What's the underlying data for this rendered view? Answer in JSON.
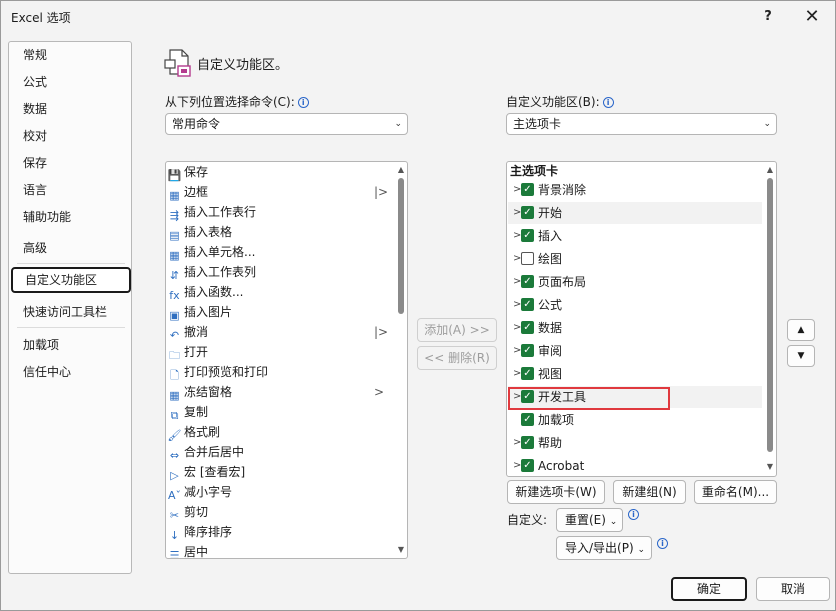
{
  "window": {
    "title": "Excel 选项",
    "help": "?",
    "close": "✕"
  },
  "sidebar": {
    "items": [
      {
        "label": "常规"
      },
      {
        "label": "公式"
      },
      {
        "label": "数据"
      },
      {
        "label": "校对"
      },
      {
        "label": "保存"
      },
      {
        "label": "语言"
      },
      {
        "label": "辅助功能"
      },
      {
        "label": "高级"
      },
      {
        "label": "自定义功能区",
        "active": true
      },
      {
        "label": "快速访问工具栏"
      },
      {
        "label": "加载项"
      },
      {
        "label": "信任中心"
      }
    ]
  },
  "header": {
    "title": "自定义功能区。",
    "icon": "customize-ribbon-icon"
  },
  "left": {
    "label": "从下列位置选择命令(C):",
    "select_value": "常用命令",
    "commands": [
      {
        "label": "保存",
        "icon": "save-icon",
        "glyph": "💾"
      },
      {
        "label": "边框",
        "icon": "border-icon",
        "glyph": "▦",
        "sub": "|>"
      },
      {
        "label": "插入工作表行",
        "icon": "insert-row-icon",
        "glyph": "⇶"
      },
      {
        "label": "插入表格",
        "icon": "table-icon",
        "glyph": "▤"
      },
      {
        "label": "插入单元格...",
        "icon": "insert-cells-icon",
        "glyph": "▦"
      },
      {
        "label": "插入工作表列",
        "icon": "insert-column-icon",
        "glyph": "⇵"
      },
      {
        "label": "插入函数...",
        "icon": "function-icon",
        "glyph": "fx"
      },
      {
        "label": "插入图片",
        "icon": "picture-icon",
        "glyph": "▣"
      },
      {
        "label": "撤消",
        "icon": "undo-icon",
        "glyph": "↶",
        "sub": "|>"
      },
      {
        "label": "打开",
        "icon": "open-folder-icon",
        "glyph": "🗀"
      },
      {
        "label": "打印预览和打印",
        "icon": "print-preview-icon",
        "glyph": "🗋"
      },
      {
        "label": "冻结窗格",
        "icon": "freeze-panes-icon",
        "glyph": "▦",
        "sub": ">"
      },
      {
        "label": "复制",
        "icon": "copy-icon",
        "glyph": "⧉"
      },
      {
        "label": "格式刷",
        "icon": "format-painter-icon",
        "glyph": "🖌"
      },
      {
        "label": "合并后居中",
        "icon": "merge-center-icon",
        "glyph": "⇔"
      },
      {
        "label": "宏 [查看宏]",
        "icon": "macro-play-icon",
        "glyph": "▷"
      },
      {
        "label": "减小字号",
        "icon": "decrease-font-icon",
        "glyph": "Aˇ"
      },
      {
        "label": "剪切",
        "icon": "scissors-icon",
        "glyph": "✂"
      },
      {
        "label": "降序排序",
        "icon": "sort-desc-icon",
        "glyph": "↓"
      },
      {
        "label": "居中",
        "icon": "align-center-icon",
        "glyph": "☰"
      }
    ]
  },
  "middle": {
    "add": "添加(A) >>",
    "remove": "<< 删除(R)"
  },
  "right": {
    "label": "自定义功能区(B):",
    "select_value": "主选项卡",
    "tree_head": "主选项卡",
    "tabs": [
      {
        "label": "背景消除",
        "checked": true
      },
      {
        "label": "开始",
        "checked": true
      },
      {
        "label": "插入",
        "checked": true
      },
      {
        "label": "绘图",
        "checked": false
      },
      {
        "label": "页面布局",
        "checked": true
      },
      {
        "label": "公式",
        "checked": true
      },
      {
        "label": "数据",
        "checked": true
      },
      {
        "label": "审阅",
        "checked": true
      },
      {
        "label": "视图",
        "checked": true
      },
      {
        "label": "开发工具",
        "checked": true
      },
      {
        "label": "加载项",
        "checked": true
      },
      {
        "label": "帮助",
        "checked": true
      },
      {
        "label": "Acrobat",
        "checked": true
      }
    ],
    "new_tab": "新建选项卡(W)",
    "new_group": "新建组(N)",
    "rename": "重命名(M)...",
    "customize_label": "自定义:",
    "reset": "重置(E)",
    "import_export": "导入/导出(P)"
  },
  "footer": {
    "ok": "确定",
    "cancel": "取消"
  },
  "colors": {
    "checkbox": "#1b7a3a",
    "highlight": "#e0393e"
  }
}
